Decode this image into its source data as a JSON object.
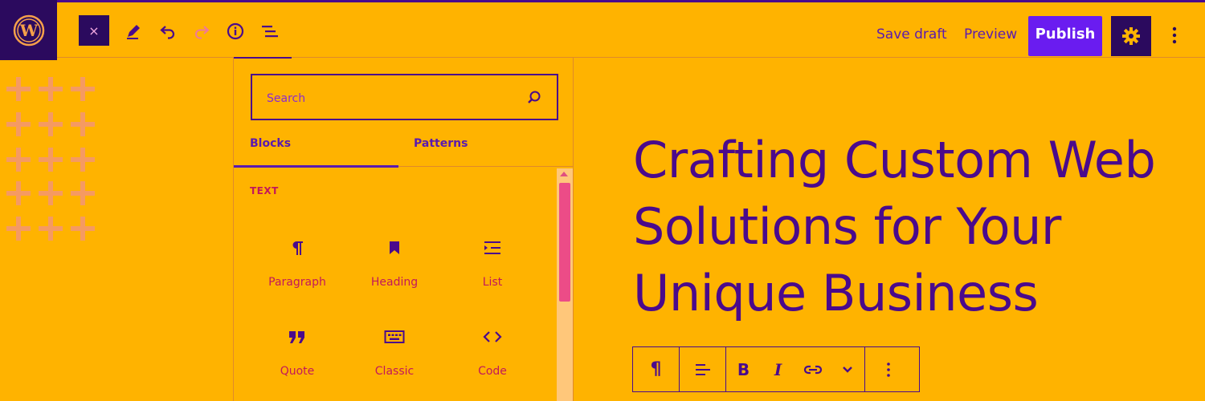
{
  "header": {
    "close_label": "×",
    "save_draft": "Save draft",
    "preview": "Preview",
    "publish": "Publish"
  },
  "inserter": {
    "search_placeholder": "Search",
    "tabs": [
      {
        "label": "Blocks",
        "active": true
      },
      {
        "label": "Patterns",
        "active": false
      }
    ],
    "category": "TEXT",
    "blocks": [
      {
        "label": "Paragraph",
        "icon": "paragraph-icon"
      },
      {
        "label": "Heading",
        "icon": "heading-icon"
      },
      {
        "label": "List",
        "icon": "list-icon"
      },
      {
        "label": "Quote",
        "icon": "quote-icon"
      },
      {
        "label": "Classic",
        "icon": "keyboard-icon"
      },
      {
        "label": "Code",
        "icon": "code-icon"
      }
    ]
  },
  "canvas": {
    "heading": "Crafting Custom Web Solutions for Your Unique Business"
  },
  "block_toolbar": {
    "paragraph_symbol": "¶",
    "bold": "B",
    "italic": "I"
  },
  "colors": {
    "background": "#FFB300",
    "text": "#4A0A8C",
    "dark": "#2B0A5E",
    "publish": "#6A1CF0",
    "accent_pink": "#C2185B"
  }
}
